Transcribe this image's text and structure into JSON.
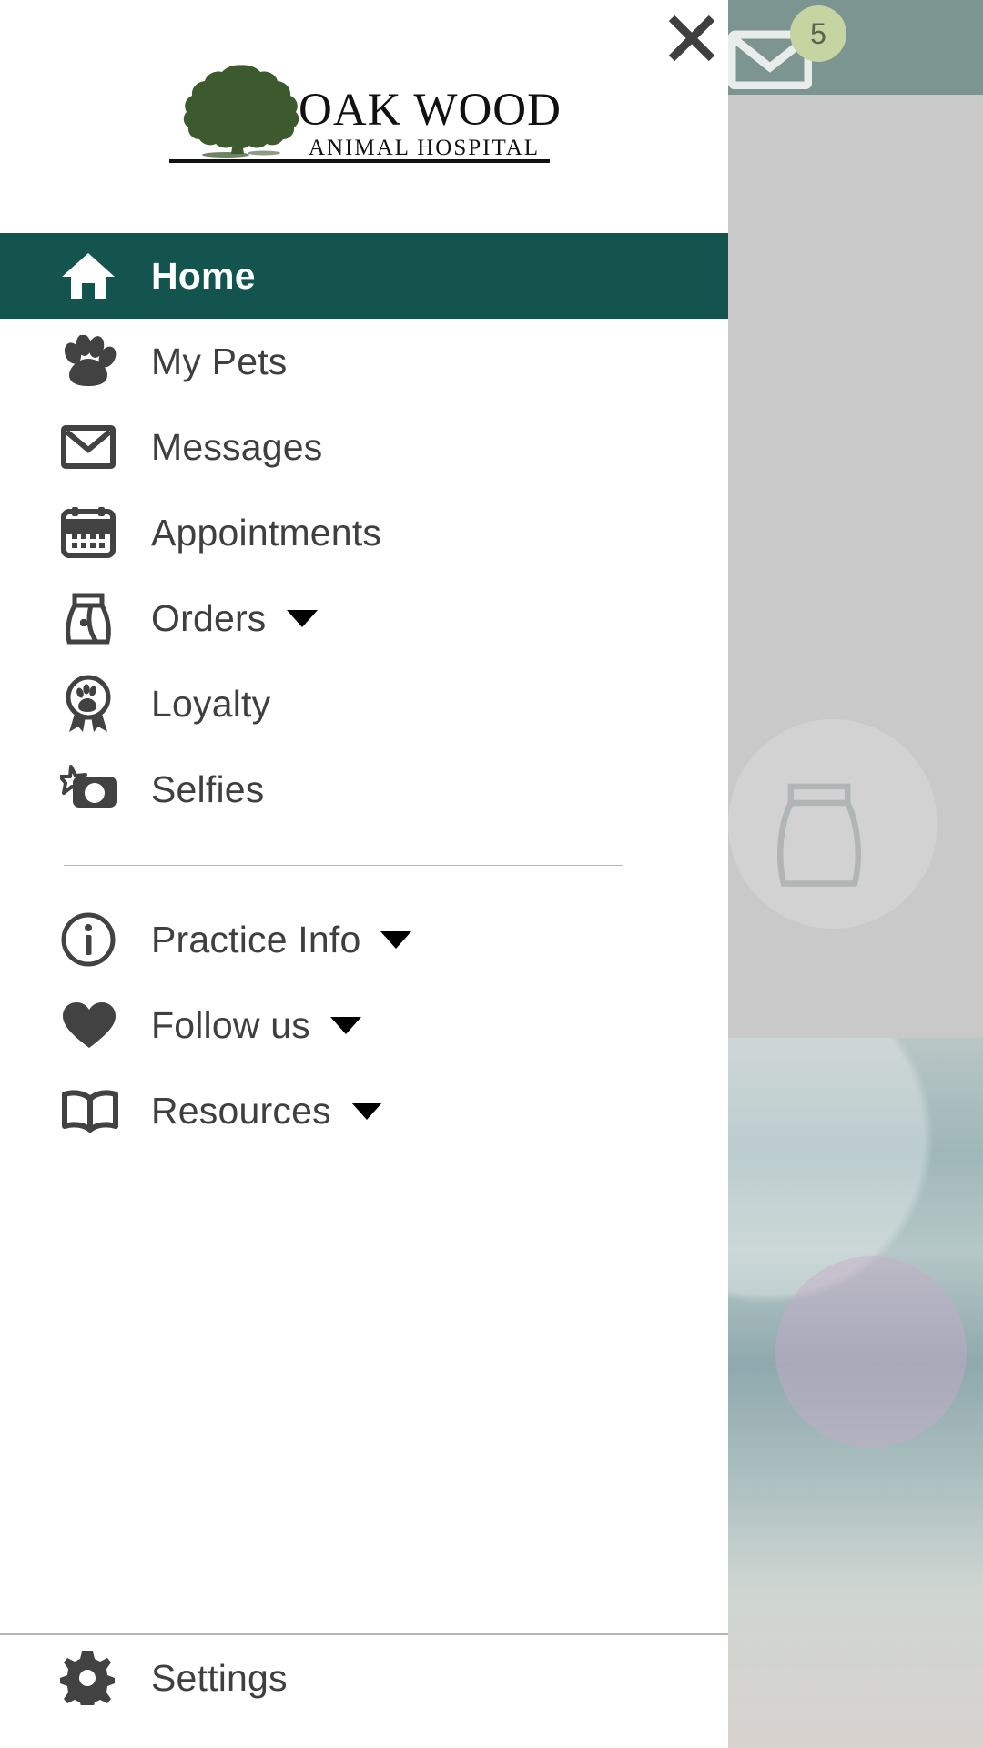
{
  "background": {
    "header_badge_count": "5",
    "envelope_icon": "envelope-icon",
    "header_color": "#7d9590",
    "badge_color": "#c5d4a0"
  },
  "drawer": {
    "close_label": "close-icon",
    "brand": {
      "line1": "OAK WOOD",
      "line2": "ANIMAL HOSPITAL",
      "tree_icon": "oak-tree-icon",
      "tree_color": "#3D5A2E",
      "text_color": "#111111"
    },
    "active_color": "#13544F",
    "icon_color": "#424242",
    "label_color": "#3f3f3f",
    "primary_items": [
      {
        "label": "Home",
        "icon": "home-icon",
        "active": true,
        "has_caret": false
      },
      {
        "label": "My Pets",
        "icon": "paw-icon",
        "active": false,
        "has_caret": false
      },
      {
        "label": "Messages",
        "icon": "envelope-icon",
        "active": false,
        "has_caret": false
      },
      {
        "label": "Appointments",
        "icon": "calendar-icon",
        "active": false,
        "has_caret": false
      },
      {
        "label": "Orders",
        "icon": "food-bag-icon",
        "active": false,
        "has_caret": true
      },
      {
        "label": "Loyalty",
        "icon": "award-paw-icon",
        "active": false,
        "has_caret": false
      },
      {
        "label": "Selfies",
        "icon": "camera-star-icon",
        "active": false,
        "has_caret": false
      }
    ],
    "secondary_items": [
      {
        "label": "Practice Info",
        "icon": "info-circle-icon",
        "active": false,
        "has_caret": true
      },
      {
        "label": "Follow us",
        "icon": "heart-icon",
        "active": false,
        "has_caret": true
      },
      {
        "label": "Resources",
        "icon": "book-icon",
        "active": false,
        "has_caret": true
      }
    ],
    "footer_items": [
      {
        "label": "Settings",
        "icon": "gear-icon",
        "active": false,
        "has_caret": false
      }
    ]
  }
}
